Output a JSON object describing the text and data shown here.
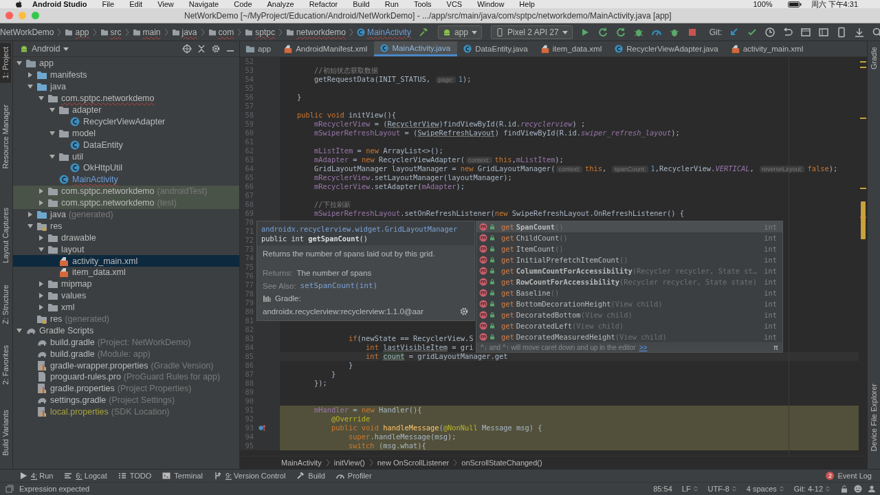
{
  "menu_bar": {
    "app": "Android Studio",
    "items": [
      "File",
      "Edit",
      "View",
      "Navigate",
      "Code",
      "Analyze",
      "Refactor",
      "Build",
      "Run",
      "Tools",
      "VCS",
      "Window",
      "Help"
    ],
    "battery": "100%",
    "clock": "周六 下午4:31"
  },
  "window": {
    "title": "NetWorkDemo [~/MyProject/Education/Android/NetWorkDemo] - .../app/src/main/java/com/sptpc/networkdemo/MainActivity.java [app]"
  },
  "breadcrumbs": [
    {
      "label": "NetWorkDemo",
      "kind": "project"
    },
    {
      "label": "app",
      "kind": "folder"
    },
    {
      "label": "src",
      "kind": "folder"
    },
    {
      "label": "main",
      "kind": "folder"
    },
    {
      "label": "java",
      "kind": "folder"
    },
    {
      "label": "com",
      "kind": "folder"
    },
    {
      "label": "sptpc",
      "kind": "folder"
    },
    {
      "label": "networkdemo",
      "kind": "folder"
    },
    {
      "label": "MainActivity",
      "kind": "class"
    }
  ],
  "toolbar": {
    "config": "app",
    "device": "Pixel 2 API 27",
    "vcs_label": "Git:"
  },
  "left_strip": [
    {
      "label": "1: Project",
      "selected": true
    },
    {
      "label": "Resource Manager",
      "selected": false
    },
    {
      "label": "Layout Captures",
      "selected": false
    },
    {
      "label": "Z: Structure",
      "selected": false
    },
    {
      "label": "2: Favorites",
      "selected": false
    },
    {
      "label": "Build Variants",
      "selected": false
    }
  ],
  "right_strip": [
    "Gradle",
    "Device File Explorer"
  ],
  "project_panel": {
    "view": "Android",
    "tree": [
      {
        "label": "app",
        "kind": "module",
        "expanded": true,
        "selected": false,
        "test": false,
        "modified": false,
        "ignored": false,
        "error": false,
        "children": [
          {
            "label": "manifests",
            "kind": "source-folder",
            "expanded": false,
            "selected": false,
            "test": false,
            "modified": false,
            "ignored": false,
            "error": false
          },
          {
            "label": "java",
            "kind": "source-folder",
            "expanded": true,
            "selected": false,
            "test": false,
            "modified": false,
            "ignored": false,
            "error": false,
            "children": [
              {
                "label": "com.sptpc.networkdemo",
                "kind": "package",
                "expanded": true,
                "selected": false,
                "test": false,
                "modified": false,
                "ignored": false,
                "error": true,
                "children": [
                  {
                    "label": "adapter",
                    "kind": "package",
                    "expanded": true,
                    "selected": false,
                    "test": false,
                    "modified": false,
                    "ignored": false,
                    "error": false,
                    "children": [
                      {
                        "label": "RecyclerViewAdapter",
                        "kind": "class",
                        "selected": false,
                        "test": false,
                        "modified": false,
                        "ignored": false,
                        "error": false
                      }
                    ]
                  },
                  {
                    "label": "model",
                    "kind": "package",
                    "expanded": true,
                    "selected": false,
                    "test": false,
                    "modified": false,
                    "ignored": false,
                    "error": false,
                    "children": [
                      {
                        "label": "DataEntity",
                        "kind": "class",
                        "selected": false,
                        "test": false,
                        "modified": false,
                        "ignored": false,
                        "error": false
                      }
                    ]
                  },
                  {
                    "label": "util",
                    "kind": "package",
                    "expanded": true,
                    "selected": false,
                    "test": false,
                    "modified": false,
                    "ignored": false,
                    "error": false,
                    "children": [
                      {
                        "label": "OkHttpUtil",
                        "kind": "class",
                        "selected": false,
                        "test": false,
                        "modified": false,
                        "ignored": false,
                        "error": false
                      }
                    ]
                  },
                  {
                    "label": "MainActivity",
                    "kind": "class",
                    "selected": false,
                    "test": false,
                    "modified": true,
                    "ignored": false,
                    "error": true
                  }
                ]
              },
              {
                "label": "com.sptpc.networkdemo",
                "suffix": "(androidTest)",
                "kind": "package",
                "expanded": false,
                "selected": false,
                "test": true,
                "modified": false,
                "ignored": false,
                "error": false
              },
              {
                "label": "com.sptpc.networkdemo",
                "suffix": "(test)",
                "kind": "package",
                "expanded": false,
                "selected": false,
                "test": true,
                "modified": false,
                "ignored": false,
                "error": false
              }
            ]
          },
          {
            "label": "java",
            "suffix": "(generated)",
            "kind": "generated-folder",
            "expanded": false,
            "selected": false,
            "test": false,
            "modified": false,
            "ignored": false,
            "error": false
          },
          {
            "label": "res",
            "kind": "res-folder",
            "expanded": true,
            "selected": false,
            "test": false,
            "modified": false,
            "ignored": false,
            "error": false,
            "children": [
              {
                "label": "drawable",
                "kind": "package",
                "expanded": false,
                "selected": false,
                "test": false,
                "modified": false,
                "ignored": false,
                "error": false
              },
              {
                "label": "layout",
                "kind": "package",
                "expanded": true,
                "selected": false,
                "test": false,
                "modified": false,
                "ignored": false,
                "error": false,
                "children": [
                  {
                    "label": "activity_main.xml",
                    "kind": "layout",
                    "selected": true,
                    "test": false,
                    "modified": false,
                    "ignored": false,
                    "error": false
                  },
                  {
                    "label": "item_data.xml",
                    "kind": "layout",
                    "selected": false,
                    "test": false,
                    "modified": false,
                    "ignored": false,
                    "error": false
                  }
                ]
              },
              {
                "label": "mipmap",
                "kind": "package",
                "expanded": false,
                "selected": false,
                "test": false,
                "modified": false,
                "ignored": false,
                "error": false
              },
              {
                "label": "values",
                "kind": "package",
                "expanded": false,
                "selected": false,
                "test": false,
                "modified": false,
                "ignored": false,
                "error": false
              },
              {
                "label": "xml",
                "kind": "package",
                "expanded": false,
                "selected": false,
                "test": false,
                "modified": false,
                "ignored": false,
                "error": false
              }
            ]
          },
          {
            "label": "res",
            "suffix": "(generated)",
            "kind": "res-folder",
            "selected": false,
            "test": false,
            "modified": false,
            "ignored": false,
            "error": false
          }
        ]
      },
      {
        "label": "Gradle Scripts",
        "kind": "gradle",
        "expanded": true,
        "selected": false,
        "test": false,
        "modified": false,
        "ignored": false,
        "error": false,
        "children": [
          {
            "label": "build.gradle",
            "suffix": "(Project: NetWorkDemo)",
            "kind": "gradle",
            "selected": false,
            "test": false,
            "modified": false,
            "ignored": false,
            "error": false
          },
          {
            "label": "build.gradle",
            "suffix": "(Module: app)",
            "kind": "gradle",
            "selected": false,
            "test": false,
            "modified": false,
            "ignored": false,
            "error": false
          },
          {
            "label": "gradle-wrapper.properties",
            "suffix": "(Gradle Version)",
            "kind": "properties",
            "selected": false,
            "test": false,
            "modified": false,
            "ignored": false,
            "error": false
          },
          {
            "label": "proguard-rules.pro",
            "suffix": "(ProGuard Rules for app)",
            "kind": "file",
            "selected": false,
            "test": false,
            "modified": false,
            "ignored": false,
            "error": false
          },
          {
            "label": "gradle.properties",
            "suffix": "(Project Properties)",
            "kind": "properties",
            "selected": false,
            "test": false,
            "modified": false,
            "ignored": false,
            "error": false
          },
          {
            "label": "settings.gradle",
            "suffix": "(Project Settings)",
            "kind": "gradle",
            "selected": false,
            "test": false,
            "modified": false,
            "ignored": false,
            "error": false
          },
          {
            "label": "local.properties",
            "suffix": "(SDK Location)",
            "kind": "properties",
            "selected": false,
            "test": false,
            "modified": false,
            "ignored": true,
            "error": false
          }
        ]
      }
    ]
  },
  "editor_tabs": [
    {
      "label": "app",
      "kind": "module",
      "selected": false
    },
    {
      "label": "AndroidManifest.xml",
      "kind": "xml",
      "selected": false
    },
    {
      "label": "MainActivity.java",
      "kind": "class",
      "selected": true
    },
    {
      "label": "DataEntity.java",
      "kind": "class",
      "selected": false
    },
    {
      "label": "item_data.xml",
      "kind": "xml",
      "selected": false
    },
    {
      "label": "RecyclerViewAdapter.java",
      "kind": "class",
      "selected": false
    },
    {
      "label": "activity_main.xml",
      "kind": "xml",
      "selected": false
    }
  ],
  "code": {
    "lines": [
      {
        "number": "52",
        "kind": "normal"
      },
      {
        "number": "53",
        "kind": "normal",
        "tokens": [
          {
            "kind": "comment",
            "text": "        //初始状态获取数据"
          }
        ]
      },
      {
        "number": "54",
        "kind": "normal",
        "tokens": [
          {
            "kind": "plain",
            "text": "        getRequestData(INIT_STATUS, "
          },
          {
            "kind": "hint",
            "text": "page:"
          },
          {
            "kind": "num",
            "text": "1"
          },
          {
            "kind": "plain",
            "text": ");"
          }
        ]
      },
      {
        "number": "55",
        "kind": "normal"
      },
      {
        "number": "56",
        "kind": "normal",
        "tokens": [
          {
            "kind": "plain",
            "text": "    }"
          }
        ]
      },
      {
        "number": "57",
        "kind": "normal"
      },
      {
        "number": "58",
        "kind": "normal",
        "tokens": [
          {
            "kind": "kw",
            "text": "    public void "
          },
          {
            "kind": "plain",
            "text": "initView(){"
          }
        ]
      },
      {
        "number": "59",
        "kind": "normal",
        "tokens": [
          {
            "kind": "field",
            "text": "        mRecyclerView"
          },
          {
            "kind": "plain",
            "text": " = ("
          },
          {
            "kind": "unused",
            "text": "RecyclerView"
          },
          {
            "kind": "plain",
            "text": ")findViewById(R.id."
          },
          {
            "kind": "static",
            "text": "recyclerview"
          },
          {
            "kind": "plain",
            "text": ") ;"
          }
        ]
      },
      {
        "number": "60",
        "kind": "normal",
        "tokens": [
          {
            "kind": "field",
            "text": "        mSwiperRefreshLayout"
          },
          {
            "kind": "plain",
            "text": " = ("
          },
          {
            "kind": "unused",
            "text": "SwipeRefreshLayout"
          },
          {
            "kind": "plain",
            "text": ") findViewById(R.id."
          },
          {
            "kind": "static",
            "text": "swiper_refresh_layout"
          },
          {
            "kind": "plain",
            "text": ");"
          }
        ]
      },
      {
        "number": "61",
        "kind": "normal"
      },
      {
        "number": "62",
        "kind": "normal",
        "tokens": [
          {
            "kind": "field",
            "text": "        mListItem"
          },
          {
            "kind": "plain",
            "text": " = "
          },
          {
            "kind": "kw",
            "text": "new "
          },
          {
            "kind": "plain",
            "text": "ArrayList<>();"
          }
        ]
      },
      {
        "number": "63",
        "kind": "normal",
        "tokens": [
          {
            "kind": "field",
            "text": "        mAdapter"
          },
          {
            "kind": "plain",
            "text": " = "
          },
          {
            "kind": "kw",
            "text": "new "
          },
          {
            "kind": "plain",
            "text": "RecyclerViewAdapter("
          },
          {
            "kind": "hint",
            "text": "context:"
          },
          {
            "kind": "kw",
            "text": "this"
          },
          {
            "kind": "plain",
            "text": ","
          },
          {
            "kind": "field",
            "text": "mListItem"
          },
          {
            "kind": "plain",
            "text": ");"
          }
        ]
      },
      {
        "number": "64",
        "kind": "normal",
        "tokens": [
          {
            "kind": "plain",
            "text": "        GridLayoutManager layoutManager = "
          },
          {
            "kind": "kw",
            "text": "new "
          },
          {
            "kind": "plain",
            "text": "GridLayoutManager("
          },
          {
            "kind": "hint",
            "text": "context:"
          },
          {
            "kind": "kw",
            "text": "this"
          },
          {
            "kind": "plain",
            "text": ", "
          },
          {
            "kind": "hint",
            "text": "spanCount:"
          },
          {
            "kind": "num",
            "text": "1"
          },
          {
            "kind": "plain",
            "text": ",RecyclerView."
          },
          {
            "kind": "static",
            "text": "VERTICAL"
          },
          {
            "kind": "plain",
            "text": ", "
          },
          {
            "kind": "hint",
            "text": "reverseLayout:"
          },
          {
            "kind": "kw",
            "text": "false"
          },
          {
            "kind": "plain",
            "text": ");"
          }
        ]
      },
      {
        "number": "65",
        "kind": "normal",
        "tokens": [
          {
            "kind": "field",
            "text": "        mRecyclerView"
          },
          {
            "kind": "plain",
            "text": ".setLayoutManager(layoutManager);"
          }
        ]
      },
      {
        "number": "66",
        "kind": "normal",
        "tokens": [
          {
            "kind": "field",
            "text": "        mRecyclerView"
          },
          {
            "kind": "plain",
            "text": ".setAdapter("
          },
          {
            "kind": "field",
            "text": "mAdapter"
          },
          {
            "kind": "plain",
            "text": ");"
          }
        ]
      },
      {
        "number": "67",
        "kind": "normal"
      },
      {
        "number": "68",
        "kind": "normal",
        "tokens": [
          {
            "kind": "comment",
            "text": "        //下拉刷新"
          }
        ]
      },
      {
        "number": "69",
        "kind": "normal",
        "tokens": [
          {
            "kind": "field",
            "text": "        mSwiperRefreshLayout"
          },
          {
            "kind": "plain",
            "text": ".setOnRefreshListener("
          },
          {
            "kind": "kw",
            "text": "new "
          },
          {
            "kind": "plain",
            "text": "SwipeRefreshLayout.OnRefreshListener() {"
          }
        ]
      },
      {
        "number": "70",
        "kind": "normal"
      },
      {
        "number": "71",
        "kind": "normal"
      },
      {
        "number": "72",
        "kind": "normal"
      },
      {
        "number": "73",
        "kind": "normal"
      },
      {
        "number": "74",
        "kind": "normal"
      },
      {
        "number": "75",
        "kind": "normal"
      },
      {
        "number": "76",
        "kind": "normal"
      },
      {
        "number": "77",
        "kind": "normal"
      },
      {
        "number": "78",
        "kind": "normal"
      },
      {
        "number": "79",
        "kind": "normal"
      },
      {
        "number": "80",
        "kind": "normal"
      },
      {
        "number": "81",
        "kind": "normal"
      },
      {
        "number": "82",
        "kind": "normal"
      },
      {
        "number": "83",
        "kind": "normal",
        "tokens": [
          {
            "kind": "kw",
            "text": "                if"
          },
          {
            "kind": "plain",
            "text": "(newState == RecyclerView.S"
          }
        ]
      },
      {
        "number": "84",
        "kind": "normal",
        "tokens": [
          {
            "kind": "kw",
            "text": "                    int "
          },
          {
            "kind": "unused",
            "text": "lastVisibleItem"
          },
          {
            "kind": "plain",
            "text": " = gri"
          }
        ]
      },
      {
        "number": "85",
        "kind": "current",
        "tokens": [
          {
            "kind": "kw",
            "text": "                    int "
          },
          {
            "kind": "usage",
            "text": "count"
          },
          {
            "kind": "plain",
            "text": " = gridLayoutManager.get"
          }
        ]
      },
      {
        "number": "86",
        "kind": "normal",
        "tokens": [
          {
            "kind": "plain",
            "text": "                }"
          }
        ]
      },
      {
        "number": "87",
        "kind": "normal",
        "tokens": [
          {
            "kind": "plain",
            "text": "            }"
          }
        ]
      },
      {
        "number": "88",
        "kind": "normal",
        "tokens": [
          {
            "kind": "plain",
            "text": "        });"
          }
        ]
      },
      {
        "number": "89",
        "kind": "normal"
      },
      {
        "number": "90",
        "kind": "normal"
      },
      {
        "number": "91",
        "kind": "highlighted",
        "tokens": [
          {
            "kind": "field",
            "text": "        mHandler"
          },
          {
            "kind": "plain",
            "text": " = "
          },
          {
            "kind": "kw",
            "text": "new "
          },
          {
            "kind": "plain",
            "text": "Handler(){"
          }
        ]
      },
      {
        "number": "92",
        "kind": "highlighted",
        "tokens": [
          {
            "kind": "annotation",
            "text": "            @Override"
          }
        ]
      },
      {
        "number": "93",
        "kind": "highlighted",
        "overridden": true,
        "tokens": [
          {
            "kind": "kw",
            "text": "            public void "
          },
          {
            "kind": "method",
            "text": "handleMessage"
          },
          {
            "kind": "plain",
            "text": "("
          },
          {
            "kind": "annotation",
            "text": "@NonNull"
          },
          {
            "kind": "plain",
            "text": " Message msg) {"
          }
        ]
      },
      {
        "number": "94",
        "kind": "highlighted",
        "tokens": [
          {
            "kind": "kw",
            "text": "                super"
          },
          {
            "kind": "plain",
            "text": ".handleMessage(msg);"
          }
        ]
      },
      {
        "number": "95",
        "kind": "highlighted",
        "tokens": [
          {
            "kind": "kw",
            "text": "                switch "
          },
          {
            "kind": "plain",
            "text": "(msg.what){"
          }
        ]
      }
    ]
  },
  "doc_popup": {
    "class_name": "androidx.recyclerview.widget.GridLayoutManager",
    "signature": "public int **getSpanCount**()",
    "description": "Returns the number of spans laid out by this grid.",
    "returns_label": "Returns:",
    "returns": "The number of spans",
    "see_also_label": "See Also:",
    "see_also": "setSpanCount(int)",
    "source_label": "Gradle:",
    "source": "androidx.recyclerview:recyclerview:1.1.0@aar"
  },
  "completion": {
    "items": [
      {
        "match": "get",
        "name": "SpanCount",
        "bold": true,
        "params": "()",
        "type": "int",
        "selected": true
      },
      {
        "match": "get",
        "name": "ChildCount",
        "bold": false,
        "params": "()",
        "type": "int",
        "selected": false
      },
      {
        "match": "get",
        "name": "ItemCount",
        "bold": false,
        "params": "()",
        "type": "int",
        "selected": false
      },
      {
        "match": "get",
        "name": "InitialPrefetchItemCount",
        "bold": false,
        "params": "()",
        "type": "int",
        "selected": false
      },
      {
        "match": "get",
        "name": "ColumnCountForAccessibility",
        "bold": true,
        "params": "(Recycler recycler, State st…",
        "type": "int",
        "selected": false
      },
      {
        "match": "get",
        "name": "RowCountForAccessibility",
        "bold": true,
        "params": "(Recycler recycler, State state)",
        "type": "int",
        "selected": false
      },
      {
        "match": "get",
        "name": "Baseline",
        "bold": false,
        "params": "()",
        "type": "int",
        "selected": false
      },
      {
        "match": "get",
        "name": "BottomDecorationHeight",
        "bold": false,
        "params": "(View child)",
        "type": "int",
        "selected": false
      },
      {
        "match": "get",
        "name": "DecoratedBottom",
        "bold": false,
        "params": "(View child)",
        "type": "int",
        "selected": false
      },
      {
        "match": "get",
        "name": "DecoratedLeft",
        "bold": false,
        "params": "(View child)",
        "type": "int",
        "selected": false
      },
      {
        "match": "get",
        "name": "DecoratedMeasuredHeight",
        "bold": false,
        "params": "(View child)",
        "type": "int",
        "selected": false
      }
    ],
    "footer": "^↓ and ^↑ will move caret down and up in the editor",
    "footer_link": ">>",
    "pin": "π"
  },
  "editor_breadcrumbs": [
    "MainActivity",
    "initView()",
    "new OnScrollListener",
    "onScrollStateChanged()"
  ],
  "tool_windows": [
    {
      "label": "4: Run",
      "kind": "run",
      "mnemonic": true
    },
    {
      "label": "6: Logcat",
      "kind": "logcat",
      "mnemonic": true
    },
    {
      "label": "TODO",
      "kind": "todo",
      "mnemonic": false
    },
    {
      "label": "Terminal",
      "kind": "terminal",
      "mnemonic": false
    },
    {
      "label": "9: Version Control",
      "kind": "vcs",
      "mnemonic": true
    },
    {
      "label": "Build",
      "kind": "build",
      "mnemonic": false
    },
    {
      "label": "Profiler",
      "kind": "profiler",
      "mnemonic": false
    }
  ],
  "event_log": {
    "label": "Event Log",
    "count": "2"
  },
  "status_bar": {
    "message": "Expression expected",
    "items": [
      {
        "label": "85:54",
        "kind": "plain"
      },
      {
        "label": "LF",
        "kind": "dropdown"
      },
      {
        "label": "UTF-8",
        "kind": "dropdown"
      },
      {
        "label": "4 spaces",
        "kind": "dropdown"
      },
      {
        "label": "Git: 4-12",
        "kind": "dropdown"
      }
    ]
  }
}
